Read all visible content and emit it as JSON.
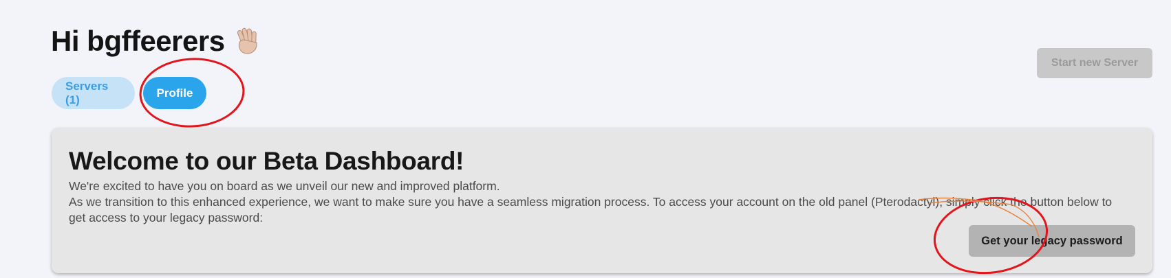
{
  "header": {
    "greeting": "Hi bgffeerers",
    "wave_icon": "waving-hand-icon"
  },
  "tabs": [
    {
      "label": "Servers (1)",
      "active": false
    },
    {
      "label": "Profile",
      "active": true
    }
  ],
  "actions": {
    "start_new_server_label": "Start new Server"
  },
  "beta_card": {
    "title": "Welcome to our Beta Dashboard!",
    "paragraph_1": "We're excited to have you on board as we unveil our new and improved platform.",
    "paragraph_2": "As we transition to this enhanced experience, we want to make sure you have a seamless migration process. To access your account on the old panel (Pterodactyl), simply click the button below to get access to your legacy password:",
    "legacy_button_label": "Get your legacy password"
  },
  "colors": {
    "background": "#f3f4f9",
    "accent": "#2aa5ec",
    "accent_light": "#c6e2f7",
    "annotation_red": "#e3151c",
    "annotation_orange": "#e8823a"
  }
}
